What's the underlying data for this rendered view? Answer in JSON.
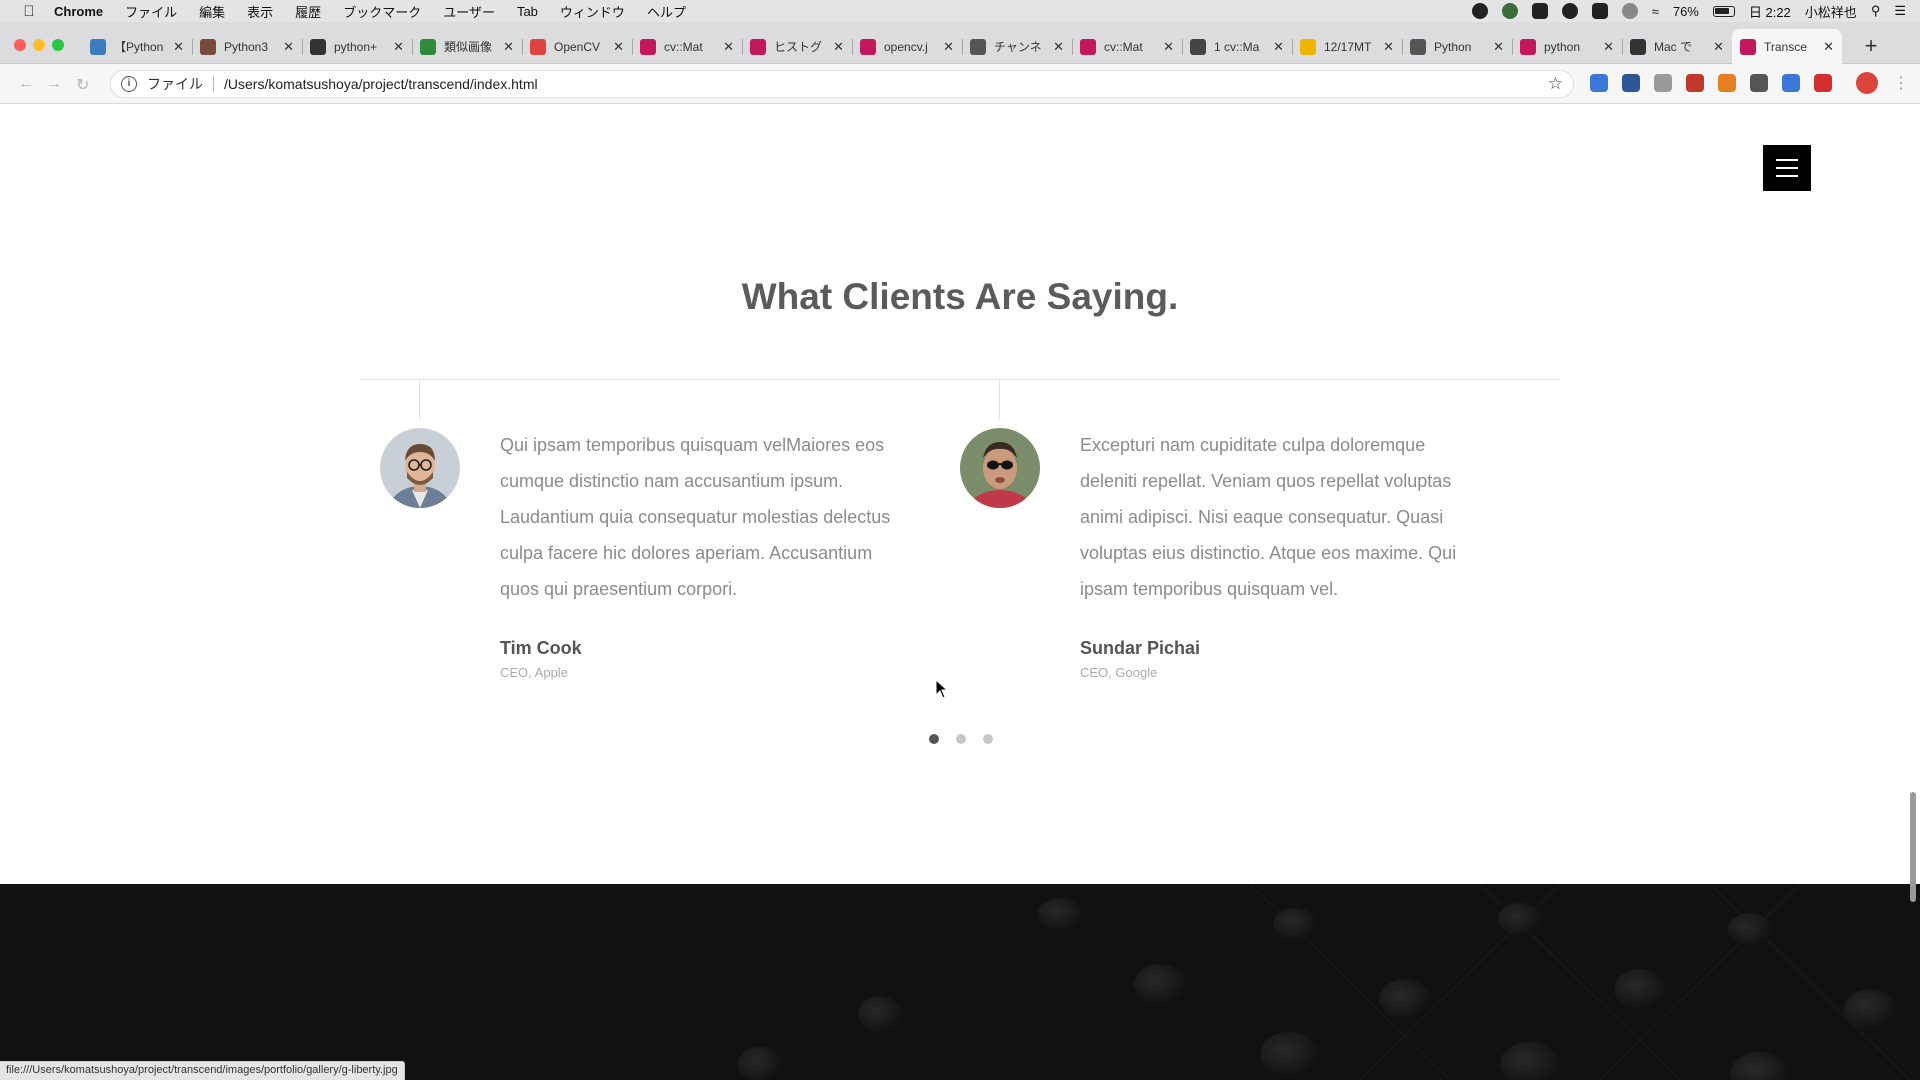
{
  "menubar": {
    "app_name": "Chrome",
    "items": [
      "ファイル",
      "編集",
      "表示",
      "履歴",
      "ブックマーク",
      "ユーザー",
      "Tab",
      "ウィンドウ",
      "ヘルプ"
    ],
    "battery": "76%",
    "clock": "日 2:22",
    "user": "小松祥也"
  },
  "tabs": [
    {
      "label": "【Python",
      "color": "#3b7bbf"
    },
    {
      "label": "Python3",
      "color": "#7a4b3a"
    },
    {
      "label": "python+",
      "color": "#333333"
    },
    {
      "label": "類似画像",
      "color": "#2e8b3a"
    },
    {
      "label": "OpenCV",
      "color": "#e0443c"
    },
    {
      "label": "cv::Mat",
      "color": "#c2185b"
    },
    {
      "label": "ヒストグ",
      "color": "#c2185b"
    },
    {
      "label": "opencv.j",
      "color": "#c2185b"
    },
    {
      "label": "チャンネ",
      "color": "#555555"
    },
    {
      "label": "cv::Mat",
      "color": "#c2185b"
    },
    {
      "label": "1 cv::Ma",
      "color": "#444444"
    },
    {
      "label": "12/17MT",
      "color": "#f2b600"
    },
    {
      "label": "Python",
      "color": "#555555"
    },
    {
      "label": "python",
      "color": "#c2185b"
    },
    {
      "label": "Mac で",
      "color": "#333333"
    },
    {
      "label": "Transce",
      "color": "#c2185b"
    }
  ],
  "omnibox": {
    "scheme_label": "ファイル",
    "url": "/Users/komatsushoya/project/transcend/index.html"
  },
  "extensions": [
    "#3b78d8",
    "#2b5797",
    "#9a9a9a",
    "#c0392b",
    "#e67e22",
    "#555555",
    "#3b78d8",
    "#d32f2f"
  ],
  "section": {
    "title": "What Clients Are Saying."
  },
  "testimonials": [
    {
      "quote_lines": [
        "Qui ipsam temporibus quisquam velMaiores eos",
        "cumque distinctio nam accusantium ipsum.",
        "Laudantium quia consequatur molestias delectus",
        "culpa facere hic dolores aperiam. Accusantium",
        "quos qui praesentium corpori."
      ],
      "name": "Tim Cook",
      "role": "CEO, Apple"
    },
    {
      "quote_lines": [
        "Excepturi nam cupiditate culpa doloremque",
        "deleniti repellat. Veniam quos repellat voluptas",
        "animi adipisci. Nisi eaque consequatur. Quasi",
        "voluptas eius distinctio. Atque eos maxime. Qui",
        "ipsam temporibus quisquam vel."
      ],
      "name": "Sundar Pichai",
      "role": "CEO, Google"
    }
  ],
  "carousel": {
    "page_count": 3,
    "active_index": 0
  },
  "statusbar": {
    "url": "file:///Users/komatsushoya/project/transcend/images/portfolio/gallery/g-liberty.jpg"
  }
}
